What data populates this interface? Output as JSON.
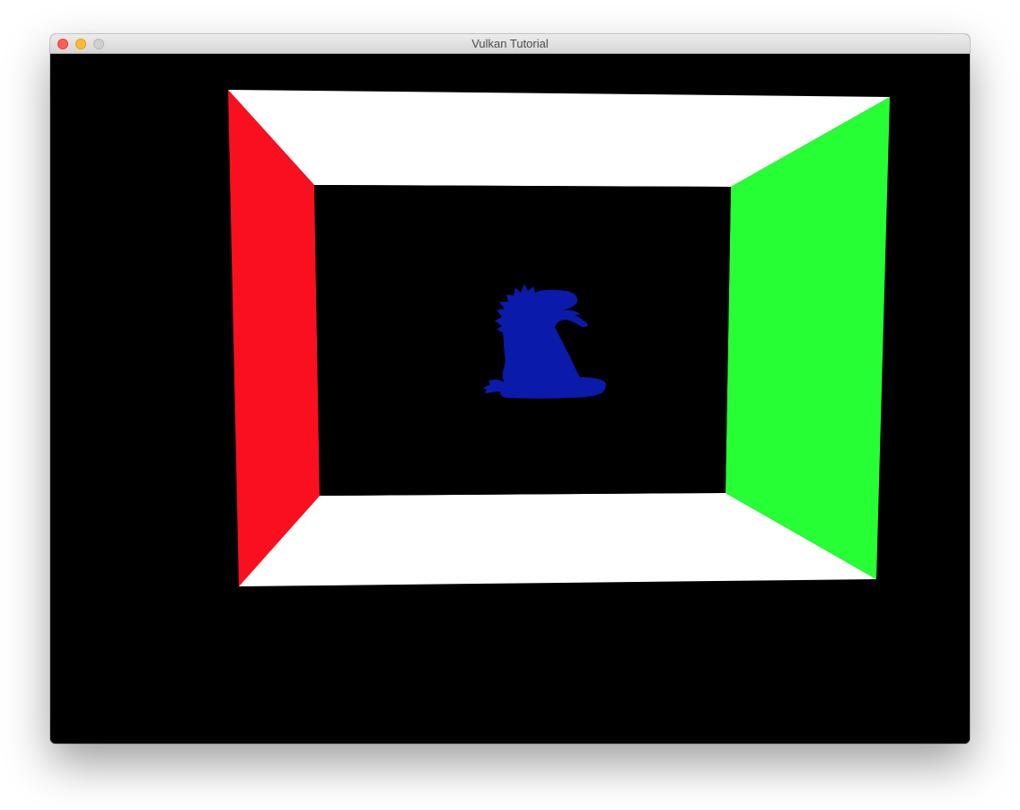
{
  "window": {
    "title": "Vulkan Tutorial",
    "buttons": [
      {
        "name": "close",
        "color": "#ff5f57",
        "border": "#e0443e"
      },
      {
        "name": "minimize",
        "color": "#febc2e",
        "border": "#dea123"
      },
      {
        "name": "zoom",
        "color": "#d0d0d0",
        "border": "#b8b8b8"
      }
    ]
  },
  "scene": {
    "background": "#000000",
    "walls": {
      "left": "#fa0f1e",
      "right": "#26ff33",
      "ceiling": "#ffffff",
      "floor": "#ffffff",
      "back": "#000000"
    },
    "model": {
      "name": "dragon-silhouette",
      "color": "#0a1aaa"
    }
  }
}
